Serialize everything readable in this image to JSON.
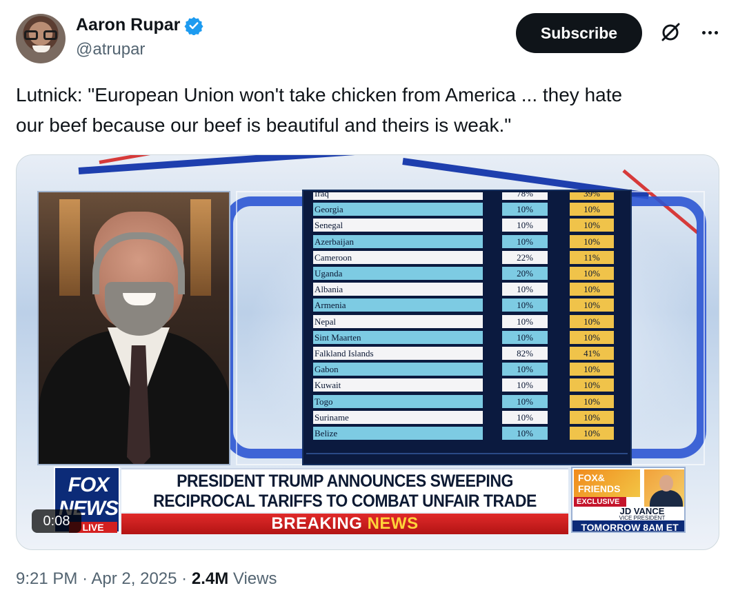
{
  "author": {
    "display_name": "Aaron Rupar",
    "handle": "@atrupar",
    "verified_icon": "verified-badge-icon",
    "verified_color": "#1d9bf0"
  },
  "actions": {
    "subscribe_label": "Subscribe",
    "grok_icon": "grok-icon",
    "more_icon": "more-icon"
  },
  "tweet": {
    "text_line1": "Lutnick: \"European Union won't take chicken from America ... they hate",
    "text_line2": "our beef because our beef is beautiful and theirs is weak.\""
  },
  "video": {
    "duration": "0:08",
    "table_rows": [
      {
        "country": "Iraq",
        "v1": "78%",
        "v2": "39%"
      },
      {
        "country": "Georgia",
        "v1": "10%",
        "v2": "10%"
      },
      {
        "country": "Senegal",
        "v1": "10%",
        "v2": "10%"
      },
      {
        "country": "Azerbaijan",
        "v1": "10%",
        "v2": "10%"
      },
      {
        "country": "Cameroon",
        "v1": "22%",
        "v2": "11%"
      },
      {
        "country": "Uganda",
        "v1": "20%",
        "v2": "10%"
      },
      {
        "country": "Albania",
        "v1": "10%",
        "v2": "10%"
      },
      {
        "country": "Armenia",
        "v1": "10%",
        "v2": "10%"
      },
      {
        "country": "Nepal",
        "v1": "10%",
        "v2": "10%"
      },
      {
        "country": "Sint Maarten",
        "v1": "10%",
        "v2": "10%"
      },
      {
        "country": "Falkland Islands",
        "v1": "82%",
        "v2": "41%"
      },
      {
        "country": "Gabon",
        "v1": "10%",
        "v2": "10%"
      },
      {
        "country": "Kuwait",
        "v1": "10%",
        "v2": "10%"
      },
      {
        "country": "Togo",
        "v1": "10%",
        "v2": "10%"
      },
      {
        "country": "Suriname",
        "v1": "10%",
        "v2": "10%"
      },
      {
        "country": "Belize",
        "v1": "10%",
        "v2": "10%"
      }
    ],
    "network": {
      "fox": "FOX",
      "news": "NEWS",
      "live": "LIVE"
    },
    "headline_line1": "PRESIDENT TRUMP ANNOUNCES SWEEPING",
    "headline_line2": "RECIPROCAL TARIFFS TO COMBAT UNFAIR TRADE PRACTICES",
    "breaking": "BREAKING",
    "breaking_news": "NEWS",
    "promo": {
      "show": "FOX& FRIENDS",
      "exclusive": "EXCLUSIVE",
      "guest": "JD VANCE",
      "guest_title": "VICE PRESIDENT",
      "time": "TOMORROW 8AM ET"
    }
  },
  "meta": {
    "time": "9:21 PM",
    "separator": "·",
    "date": "Apr 2, 2025",
    "views_count": "2.4M",
    "views_label": "Views"
  }
}
